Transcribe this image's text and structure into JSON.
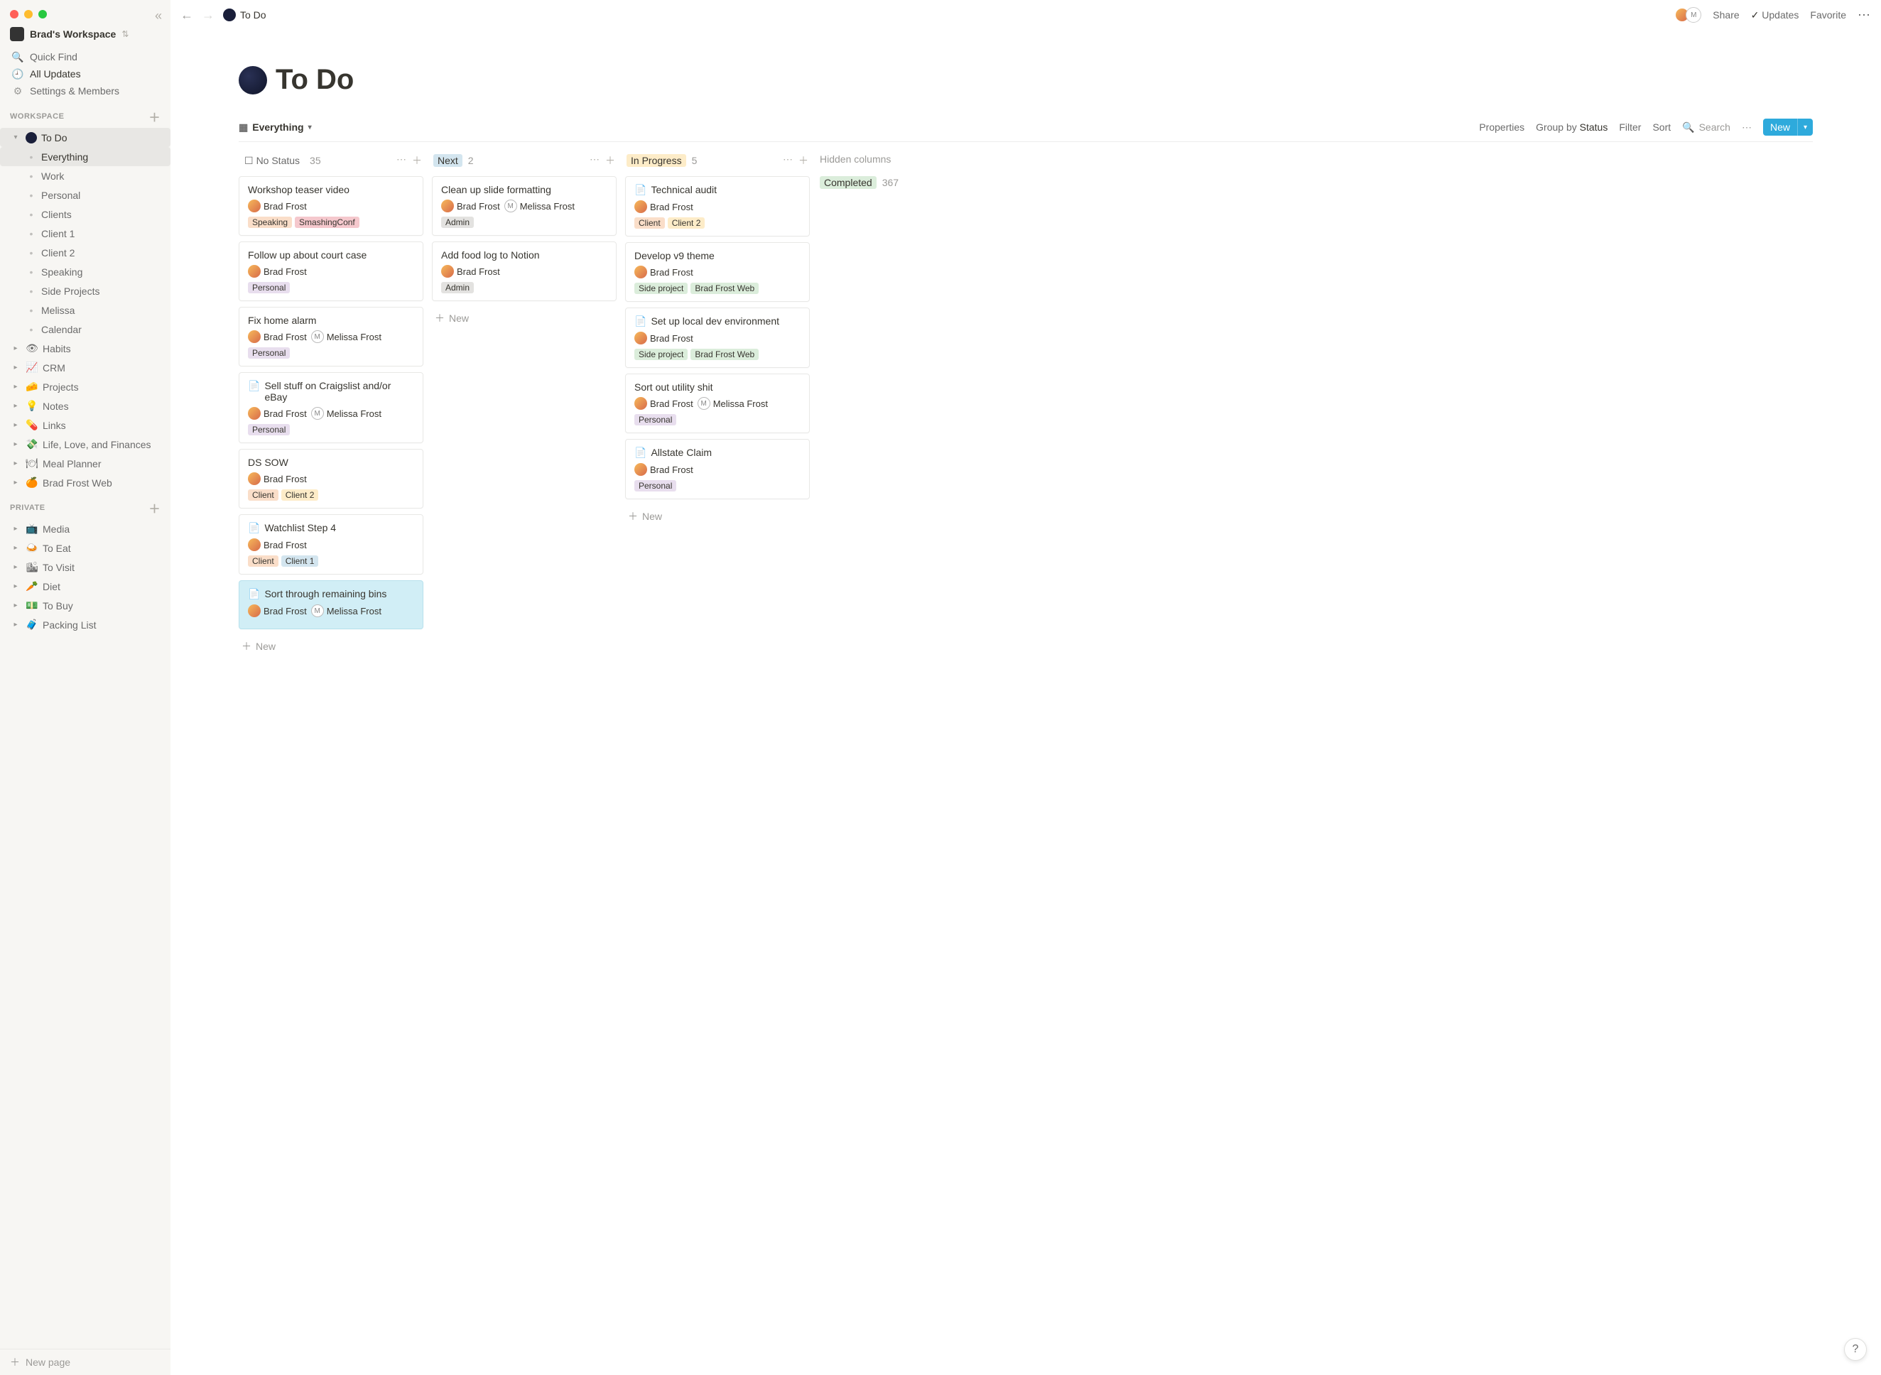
{
  "workspace": {
    "name": "Brad's Workspace"
  },
  "sidebar": {
    "quickfind": "Quick Find",
    "allupdates": "All Updates",
    "settings": "Settings & Members",
    "workspace_heading": "WORKSPACE",
    "private_heading": "PRIVATE",
    "new_page": "New page",
    "todo": {
      "label": "To Do",
      "children": [
        "Everything",
        "Work",
        "Personal",
        "Clients",
        "Client 1",
        "Client 2",
        "Speaking",
        "Side Projects",
        "Melissa",
        "Calendar"
      ]
    },
    "pages": [
      {
        "emoji": "👁",
        "label": "Habits"
      },
      {
        "emoji": "📈",
        "label": "CRM"
      },
      {
        "emoji": "🧀",
        "label": "Projects"
      },
      {
        "emoji": "💡",
        "label": "Notes"
      },
      {
        "emoji": "💊",
        "label": "Links"
      },
      {
        "emoji": "💸",
        "label": "Life, Love, and Finances"
      },
      {
        "emoji": "🍽",
        "label": "Meal Planner"
      },
      {
        "emoji": "🍊",
        "label": "Brad Frost Web"
      }
    ],
    "private_pages": [
      {
        "emoji": "📺",
        "label": "Media"
      },
      {
        "emoji": "🍛",
        "label": "To Eat"
      },
      {
        "emoji": "🏙",
        "label": "To Visit"
      },
      {
        "emoji": "🥕",
        "label": "Diet"
      },
      {
        "emoji": "💵",
        "label": "To Buy"
      },
      {
        "emoji": "🧳",
        "label": "Packing List"
      }
    ]
  },
  "topbar": {
    "breadcrumb": "To Do",
    "share": "Share",
    "updates": "Updates",
    "favorite": "Favorite"
  },
  "page": {
    "title": "To Do",
    "view_label": "Everything",
    "properties": "Properties",
    "groupby_prefix": "Group by ",
    "groupby_value": "Status",
    "filter": "Filter",
    "sort": "Sort",
    "search": "Search",
    "new_btn": "New",
    "hidden_cols": "Hidden columns",
    "new_card": "New"
  },
  "columns": [
    {
      "id": "nostatus",
      "label": "No Status",
      "count": 35,
      "cards": [
        {
          "title": "Workshop teaser video",
          "people": [
            "Brad Frost"
          ],
          "tags": [
            {
              "t": "Speaking",
              "c": "speaking"
            },
            {
              "t": "SmashingConf",
              "c": "smashing"
            }
          ]
        },
        {
          "title": "Follow up about court case",
          "people": [
            "Brad Frost"
          ],
          "tags": [
            {
              "t": "Personal",
              "c": "personal"
            }
          ]
        },
        {
          "title": "Fix home alarm",
          "people": [
            "Brad Frost",
            "Melissa Frost"
          ],
          "tags": [
            {
              "t": "Personal",
              "c": "personal"
            }
          ]
        },
        {
          "title": "Sell stuff on Craigslist and/or eBay",
          "doc": true,
          "people": [
            "Brad Frost",
            "Melissa Frost"
          ],
          "tags": [
            {
              "t": "Personal",
              "c": "personal"
            }
          ]
        },
        {
          "title": "DS SOW",
          "people": [
            "Brad Frost"
          ],
          "tags": [
            {
              "t": "Client",
              "c": "client"
            },
            {
              "t": "Client 2",
              "c": "client2"
            }
          ]
        },
        {
          "title": "Watchlist Step 4",
          "doc": true,
          "people": [
            "Brad Frost"
          ],
          "tags": [
            {
              "t": "Client",
              "c": "client"
            },
            {
              "t": "Client 1",
              "c": "client1"
            }
          ]
        },
        {
          "title": "Sort through remaining bins",
          "doc": true,
          "hl": true,
          "people": [
            "Brad Frost",
            "Melissa Frost"
          ],
          "tags": []
        }
      ]
    },
    {
      "id": "next",
      "label": "Next",
      "count": 2,
      "cards": [
        {
          "title": "Clean up slide formatting",
          "people": [
            "Brad Frost",
            "Melissa Frost"
          ],
          "tags": [
            {
              "t": "Admin",
              "c": "admin"
            }
          ]
        },
        {
          "title": "Add food log to Notion",
          "people": [
            "Brad Frost"
          ],
          "tags": [
            {
              "t": "Admin",
              "c": "admin"
            }
          ]
        }
      ]
    },
    {
      "id": "inprogress",
      "label": "In Progress",
      "count": 5,
      "cards": [
        {
          "title": "Technical audit",
          "doc": true,
          "people": [
            "Brad Frost"
          ],
          "tags": [
            {
              "t": "Client",
              "c": "client"
            },
            {
              "t": "Client 2",
              "c": "client2"
            }
          ]
        },
        {
          "title": "Develop v9 theme",
          "people": [
            "Brad Frost"
          ],
          "tags": [
            {
              "t": "Side project",
              "c": "side"
            },
            {
              "t": "Brad Frost Web",
              "c": "bfweb"
            }
          ]
        },
        {
          "title": "Set up local dev environment",
          "doc": true,
          "people": [
            "Brad Frost"
          ],
          "tags": [
            {
              "t": "Side project",
              "c": "side"
            },
            {
              "t": "Brad Frost Web",
              "c": "bfweb"
            }
          ]
        },
        {
          "title": "Sort out utility shit",
          "people": [
            "Brad Frost",
            "Melissa Frost"
          ],
          "tags": [
            {
              "t": "Personal",
              "c": "personal"
            }
          ]
        },
        {
          "title": "Allstate Claim",
          "doc": true,
          "people": [
            "Brad Frost"
          ],
          "tags": [
            {
              "t": "Personal",
              "c": "personal"
            }
          ]
        }
      ]
    }
  ],
  "hidden_column": {
    "label": "Completed",
    "count": 367
  }
}
